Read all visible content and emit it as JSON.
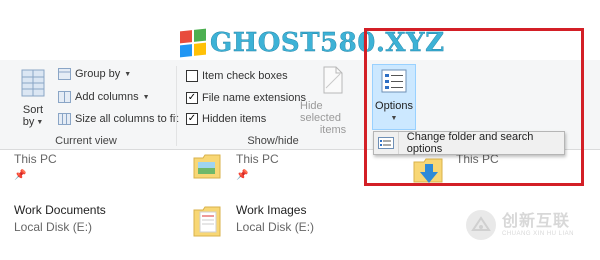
{
  "watermark": {
    "text": "GHOST580.XYZ",
    "logo_colors": [
      "#e84c3d",
      "#4caf50",
      "#2196f3",
      "#ffc107"
    ]
  },
  "ribbon": {
    "current_view": {
      "label": "Current view",
      "sort_by": "Sort",
      "sort_by_2": "by",
      "group_by": "Group by",
      "add_columns": "Add columns",
      "size_all_columns": "Size all columns to fit"
    },
    "show_hide": {
      "label": "Show/hide",
      "item_check_boxes": {
        "label": "Item check boxes",
        "checked": false
      },
      "file_name_extensions": {
        "label": "File name extensions",
        "checked": true
      },
      "hidden_items": {
        "label": "Hidden items",
        "checked": true
      },
      "hide_selected": "Hide selected",
      "hide_selected_2": "items"
    },
    "options": {
      "label": "Options",
      "dropdown_item": "Change folder and search options"
    }
  },
  "files": [
    {
      "name": "This PC",
      "sub": ""
    },
    {
      "name": "This PC",
      "sub": ""
    },
    {
      "name": "This PC",
      "sub": ""
    },
    {
      "name": "Work Documents",
      "sub": "Local Disk (E:)"
    },
    {
      "name": "Work Images",
      "sub": "Local Disk (E:)"
    }
  ],
  "brand_watermark": {
    "main": "创新互联",
    "sub": "CHUANG XIN HU LIAN"
  },
  "colors": {
    "highlight_box": "#d31f26",
    "selected_button": "#cce8ff",
    "folder_yellow": "#f8d775",
    "arrow_blue": "#2e8ad8"
  }
}
